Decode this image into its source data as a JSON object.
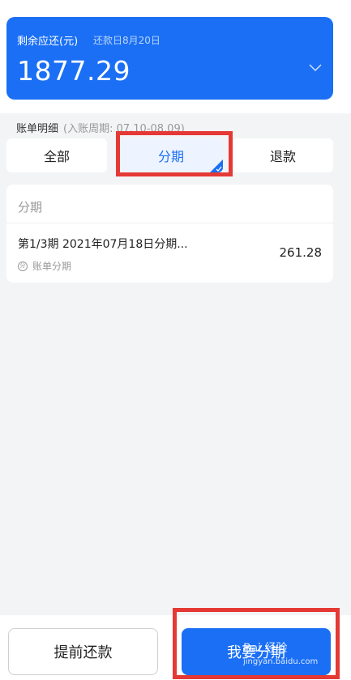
{
  "balance": {
    "title": "剩余应还(元)",
    "due_date": "还款日8月20日",
    "amount": "1877.29"
  },
  "bill_detail": {
    "label": "账单明细",
    "period": "(入账周期: 07.10-08.09)"
  },
  "tabs": [
    {
      "label": "全部"
    },
    {
      "label": "分期"
    },
    {
      "label": "退款"
    }
  ],
  "list": {
    "header": "分期",
    "items": [
      {
        "title": "第1/3期 2021年07月18日分期...",
        "subtitle": "账单分期",
        "amount": "261.28"
      }
    ]
  },
  "buttons": {
    "prepay": "提前还款",
    "installment": "我要分期"
  },
  "watermark": {
    "brand": "Bai 经验",
    "url": "jingyan.baidu.com"
  },
  "colors": {
    "accent": "#1a6ff5",
    "highlight": "#e53935"
  }
}
